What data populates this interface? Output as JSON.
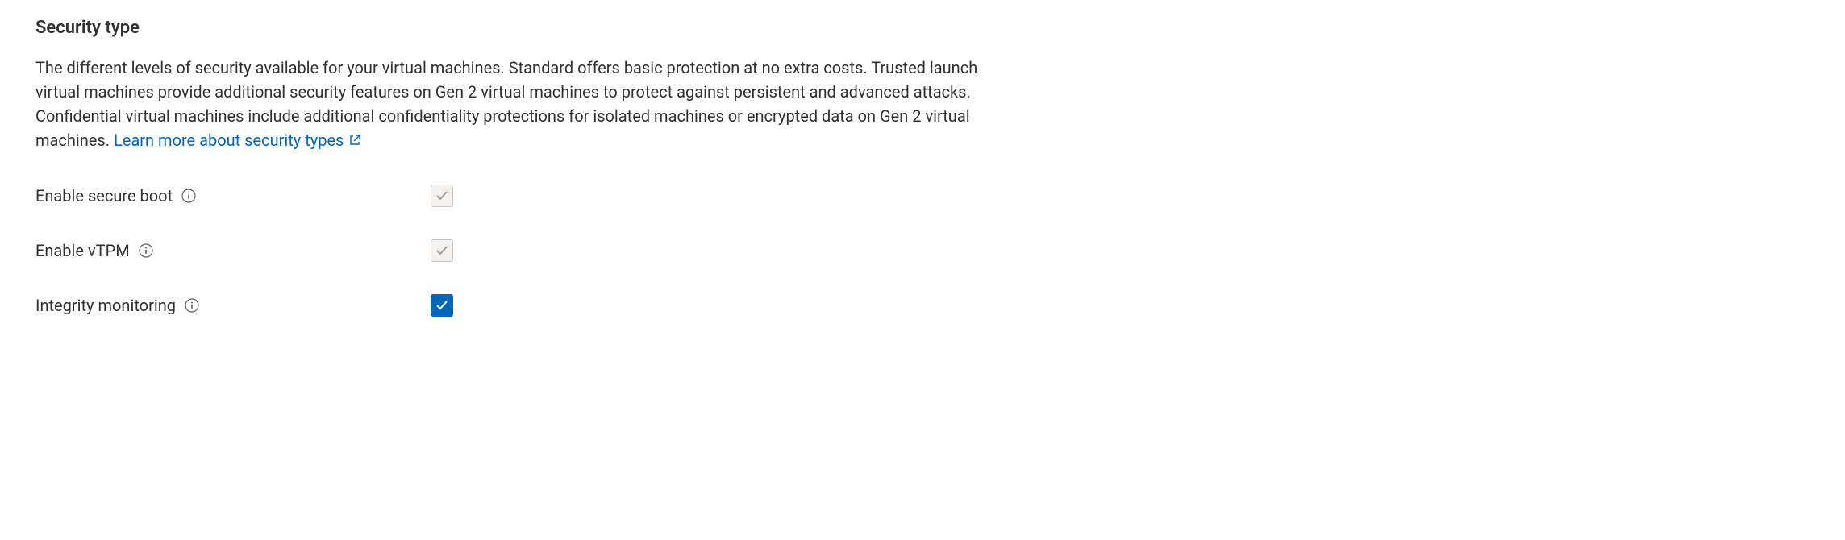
{
  "section": {
    "title": "Security type",
    "description": "The different levels of security available for your virtual machines. Standard offers basic protection at no extra costs. Trusted launch virtual machines provide additional security features on Gen 2 virtual machines to protect against persistent and advanced attacks. Confidential virtual machines include additional confidentiality protections for isolated machines or encrypted data on Gen 2 virtual machines.",
    "link_text": "Learn more about security types"
  },
  "fields": {
    "secure_boot": {
      "label": "Enable secure boot",
      "checked": true,
      "enabled": false
    },
    "vtpm": {
      "label": "Enable vTPM",
      "checked": true,
      "enabled": false
    },
    "integrity": {
      "label": "Integrity monitoring",
      "checked": true,
      "enabled": true
    }
  }
}
